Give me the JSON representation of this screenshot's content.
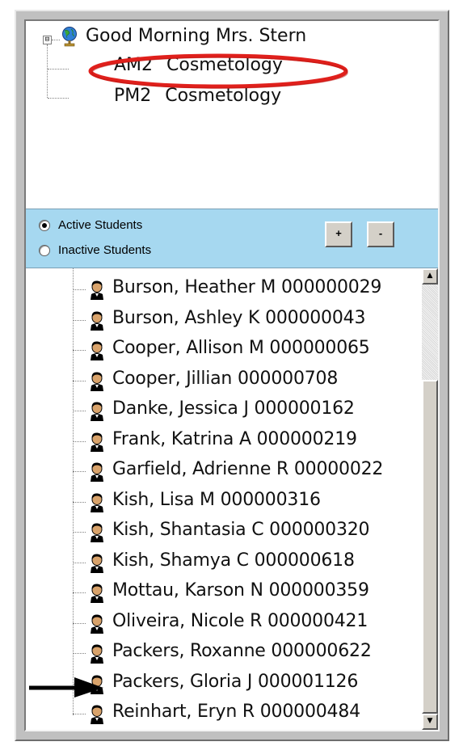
{
  "tree": {
    "expander": "⊟",
    "root_label": "Good Morning Mrs. Stern",
    "courses": [
      {
        "label": "AM2 Cosmetology"
      },
      {
        "label": "PM2 Cosmetology"
      }
    ]
  },
  "filter": {
    "active_label": "Active Students",
    "inactive_label": "Inactive Students",
    "active_checked": true,
    "plus_label": "+",
    "minus_label": "-"
  },
  "students": [
    "Burson, Heather M 000000029",
    "Burson, Ashley K 000000043",
    "Cooper, Allison M 000000065",
    "Cooper, Jillian   000000708",
    "Danke, Jessica J 000000162",
    "Frank, Katrina A 000000219",
    "Garfield, Adrienne R 00000022",
    "Kish, Lisa M 000000316",
    "Kish, Shantasia C 000000320",
    "Kish, Shamya C 000000618",
    "Mottau, Karson N 000000359",
    "Oliveira, Nicole R 000000421",
    "Packers, Roxanne   000000622",
    "Packers, Gloria J 000001126",
    "Reinhart, Eryn R 000000484"
  ],
  "scrollbar": {
    "up_glyph": "▲",
    "down_glyph": "▼"
  },
  "colors": {
    "radio_bar": "#a6d8f0",
    "highlight_ellipse": "#e0201c",
    "frame": "#c0c0c0"
  },
  "icons": {
    "root": "globe-icon",
    "student": "student-person-icon",
    "annotation": "pointer-arrow-icon"
  }
}
